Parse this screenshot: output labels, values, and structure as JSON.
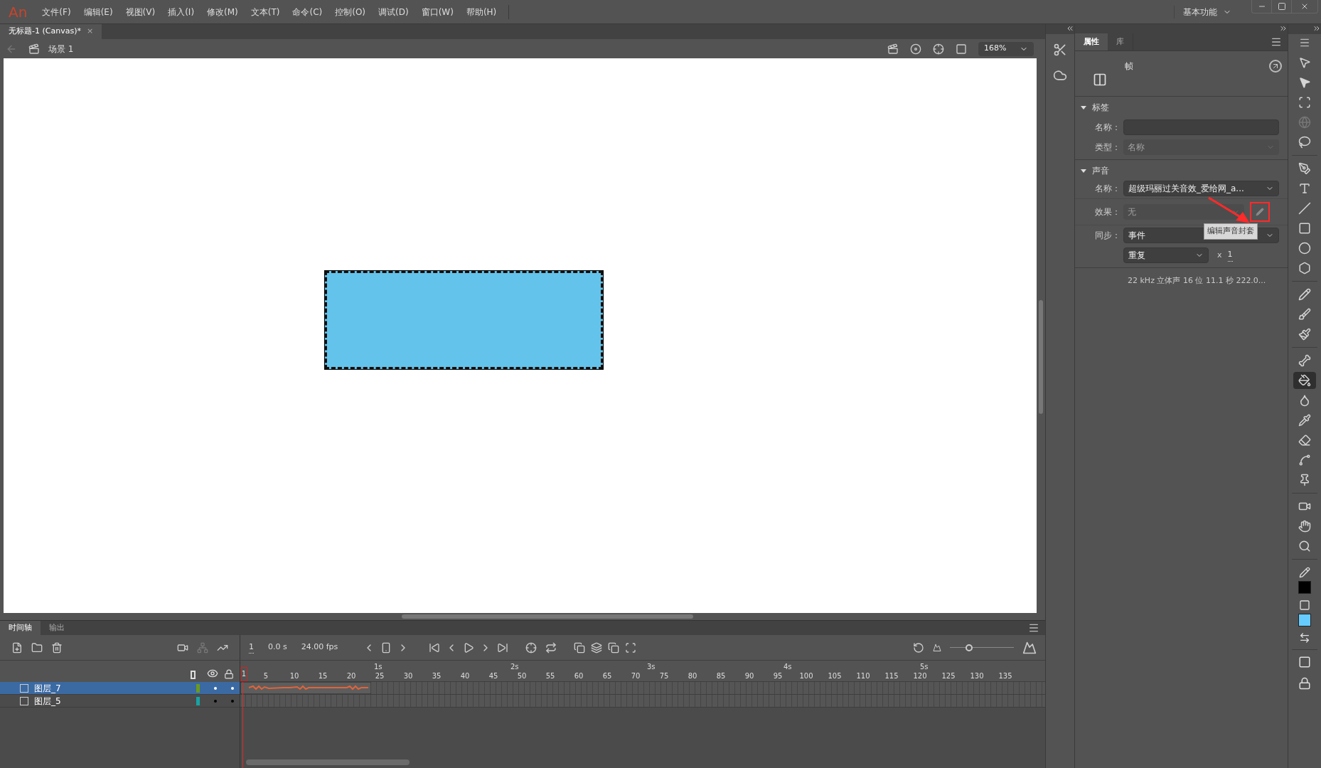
{
  "app": {
    "logo": "An",
    "menu": [
      "文件(F)",
      "编辑(E)",
      "视图(V)",
      "插入(I)",
      "修改(M)",
      "文本(T)",
      "命令(C)",
      "控制(O)",
      "调试(D)",
      "窗口(W)",
      "帮助(H)"
    ],
    "workspace": "基本功能"
  },
  "document": {
    "tab": {
      "title": "无标题-1 (Canvas)*",
      "close": "×",
      "selected": true
    },
    "scene": "场景 1",
    "zoom": "168%"
  },
  "timeline": {
    "tabs": [
      {
        "label": "时间轴",
        "selected": true
      },
      {
        "label": "输出",
        "selected": false
      }
    ],
    "current_frame": "1",
    "time": "0.0 s",
    "fps": "24.00 fps",
    "frame_labels": [
      "1",
      "5",
      "10",
      "15",
      "20",
      "25",
      "30",
      "35",
      "40",
      "45",
      "50",
      "55",
      "60",
      "65",
      "70",
      "75",
      "80",
      "85",
      "90",
      "95",
      "100",
      "105",
      "110",
      "115",
      "120",
      "125",
      "130",
      "135"
    ],
    "second_labels": [
      "1s",
      "2s",
      "3s",
      "4s",
      "5s"
    ],
    "zoom_slider": {
      "level": 0.3
    },
    "layers": [
      {
        "name": "图层_7",
        "selected": true,
        "color": "#6b9a1e",
        "sound": true
      },
      {
        "name": "图层_5",
        "selected": false,
        "color": "#17a3a3",
        "sound": false
      }
    ]
  },
  "properties": {
    "tabs": [
      {
        "label": "属性",
        "selected": true
      },
      {
        "label": "库",
        "selected": false
      }
    ],
    "title": "帧",
    "label_section": {
      "title": "标签",
      "expanded": true,
      "name_label": "名称：",
      "type_label": "类型：",
      "type_placeholder": "名称",
      "type_disabled": true
    },
    "sound_section": {
      "title": "声音",
      "expanded": true,
      "name_label": "名称：",
      "name_value": "超级玛丽过关音效_爱给网_a...",
      "effect_label": "效果：",
      "effect_value": "无",
      "effect_disabled": true,
      "sync_label": "同步：",
      "sync_value": "事件",
      "repeat_value": "重复",
      "times_sign": "x",
      "repeat_count": "1",
      "info": "22 kHz 立体声 16 位 11.1 秒 222.0..."
    },
    "tooltip": "编辑声音封套"
  },
  "tools": [
    {
      "kind": "select",
      "selected": false
    },
    {
      "kind": "subselect",
      "selected": false
    },
    {
      "kind": "transform",
      "selected": false
    },
    {
      "kind": "rotate3d",
      "selected": false
    },
    {
      "kind": "lasso",
      "selected": false
    },
    {
      "kind": "separator"
    },
    {
      "kind": "pen",
      "selected": false
    },
    {
      "kind": "text",
      "selected": false
    },
    {
      "kind": "line",
      "selected": false
    },
    {
      "kind": "rectangle",
      "selected": false
    },
    {
      "kind": "oval",
      "selected": false
    },
    {
      "kind": "polystar",
      "selected": false
    },
    {
      "kind": "separator"
    },
    {
      "kind": "pencil",
      "selected": false
    },
    {
      "kind": "paintbrush",
      "selected": false
    },
    {
      "kind": "brush",
      "selected": false
    },
    {
      "kind": "separator"
    },
    {
      "kind": "bone",
      "selected": false
    },
    {
      "kind": "bucket",
      "selected": true
    },
    {
      "kind": "ink",
      "selected": false
    },
    {
      "kind": "eyedropper",
      "selected": false
    },
    {
      "kind": "eraser",
      "selected": false
    },
    {
      "kind": "width",
      "selected": false
    },
    {
      "kind": "pin",
      "selected": false
    },
    {
      "kind": "separator"
    },
    {
      "kind": "camera",
      "selected": false
    },
    {
      "kind": "hand",
      "selected": false
    },
    {
      "kind": "zoom",
      "selected": false
    },
    {
      "kind": "separator"
    }
  ],
  "swatches": [
    {
      "kind": "stroke",
      "color": "#000000"
    },
    {
      "kind": "fill",
      "color": "#66ccff"
    }
  ]
}
